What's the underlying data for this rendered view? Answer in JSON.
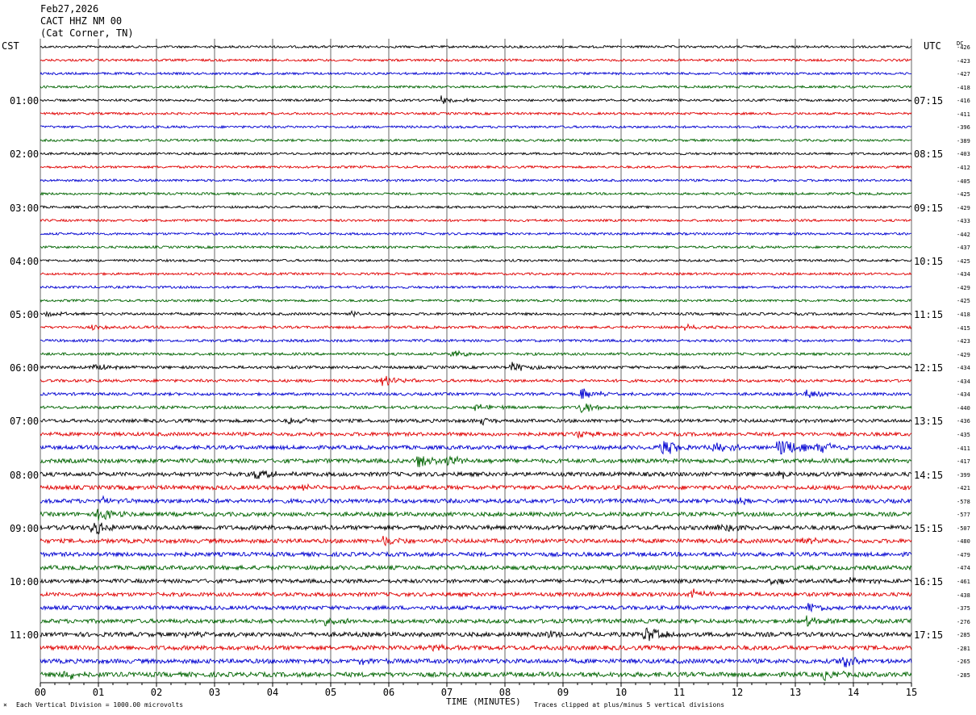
{
  "header": {
    "date": "Feb27,2026",
    "station": "CACT HHZ NM 00",
    "location": "(Cat Corner, TN)"
  },
  "axes": {
    "left_zone": "CST",
    "right_zone": "UTC",
    "dc_header": "DC",
    "xlabel": "TIME (MINUTES)",
    "footer_left": "Each Vertical Division = 1000.00 microvolts",
    "footer_right": "Traces clipped at plus/minus 5 vertical divisions",
    "footer_mark": "×"
  },
  "chart_data": {
    "type": "line",
    "title": "",
    "x_ticks": [
      "00",
      "01",
      "02",
      "03",
      "04",
      "05",
      "06",
      "07",
      "08",
      "09",
      "10",
      "11",
      "12",
      "13",
      "14",
      "15"
    ],
    "xlim": [
      0,
      15
    ],
    "trace_colors": [
      "#000000",
      "#e00000",
      "#0000d0",
      "#006400"
    ],
    "left_time_labels": [
      {
        "row": 4,
        "text": "01:00"
      },
      {
        "row": 8,
        "text": "02:00"
      },
      {
        "row": 12,
        "text": "03:00"
      },
      {
        "row": 16,
        "text": "04:00"
      },
      {
        "row": 20,
        "text": "05:00"
      },
      {
        "row": 24,
        "text": "06:00"
      },
      {
        "row": 28,
        "text": "07:00"
      },
      {
        "row": 32,
        "text": "08:00"
      },
      {
        "row": 36,
        "text": "09:00"
      },
      {
        "row": 40,
        "text": "10:00"
      },
      {
        "row": 44,
        "text": "11:00"
      }
    ],
    "right_time_labels": [
      {
        "row": 4,
        "text": "07:15"
      },
      {
        "row": 8,
        "text": "08:15"
      },
      {
        "row": 12,
        "text": "09:15"
      },
      {
        "row": 16,
        "text": "10:15"
      },
      {
        "row": 20,
        "text": "11:15"
      },
      {
        "row": 24,
        "text": "12:15"
      },
      {
        "row": 28,
        "text": "13:15"
      },
      {
        "row": 32,
        "text": "14:15"
      },
      {
        "row": 36,
        "text": "15:15"
      },
      {
        "row": 40,
        "text": "16:15"
      },
      {
        "row": 44,
        "text": "17:15"
      }
    ],
    "dc_offsets": [
      "-426",
      "-423",
      "-427",
      "-418",
      "-416",
      "-411",
      "-396",
      "-389",
      "-403",
      "-412",
      "-405",
      "-425",
      "-429",
      "-433",
      "-442",
      "-437",
      "-425",
      "-434",
      "-429",
      "-425",
      "-418",
      "-415",
      "-423",
      "-429",
      "-434",
      "-434",
      "-434",
      "-440",
      "-436",
      "-435",
      "-411",
      "-417",
      "-399",
      "-421",
      "-578",
      "-577",
      "-507",
      "-480",
      "-479",
      "-474",
      "-461",
      "-438",
      "-375",
      "-276",
      "-285",
      "-281",
      "-265",
      "-285"
    ],
    "base_noise": [
      0.9,
      0.9,
      0.9,
      0.9,
      0.9,
      0.9,
      0.9,
      0.9,
      0.9,
      0.9,
      0.9,
      0.9,
      0.9,
      0.9,
      0.9,
      0.9,
      0.9,
      0.9,
      0.9,
      0.9,
      1.0,
      1.0,
      1.0,
      1.0,
      1.1,
      1.1,
      1.1,
      1.1,
      1.3,
      1.4,
      1.5,
      1.6,
      1.6,
      1.6,
      1.6,
      1.6,
      1.7,
      1.6,
      1.6,
      1.6,
      1.5,
      1.5,
      1.5,
      1.6,
      1.7,
      1.7,
      1.7,
      1.8
    ],
    "events": [
      {
        "row": 4,
        "minute": 6.9,
        "amp": 5
      },
      {
        "row": 20,
        "minute": 0.1,
        "amp": 3
      },
      {
        "row": 20,
        "minute": 5.3,
        "amp": 3
      },
      {
        "row": 21,
        "minute": 0.9,
        "amp": 3
      },
      {
        "row": 21,
        "minute": 11.1,
        "amp": 3
      },
      {
        "row": 23,
        "minute": 7.1,
        "amp": 4
      },
      {
        "row": 24,
        "minute": 0.9,
        "amp": 5
      },
      {
        "row": 24,
        "minute": 8.1,
        "amp": 7
      },
      {
        "row": 25,
        "minute": 5.9,
        "amp": 7
      },
      {
        "row": 26,
        "minute": 9.3,
        "amp": 9
      },
      {
        "row": 26,
        "minute": 13.2,
        "amp": 5
      },
      {
        "row": 27,
        "minute": 7.5,
        "amp": 5
      },
      {
        "row": 27,
        "minute": 9.3,
        "amp": 8
      },
      {
        "row": 28,
        "minute": 4.3,
        "amp": 4
      },
      {
        "row": 28,
        "minute": 7.6,
        "amp": 4
      },
      {
        "row": 29,
        "minute": 9.2,
        "amp": 5
      },
      {
        "row": 30,
        "minute": 10.7,
        "amp": 12
      },
      {
        "row": 30,
        "minute": 11.6,
        "amp": 8
      },
      {
        "row": 30,
        "minute": 12.7,
        "amp": 18
      },
      {
        "row": 30,
        "minute": 13.4,
        "amp": 9
      },
      {
        "row": 31,
        "minute": 6.5,
        "amp": 10
      },
      {
        "row": 31,
        "minute": 7.0,
        "amp": 8
      },
      {
        "row": 32,
        "minute": 3.7,
        "amp": 8
      },
      {
        "row": 32,
        "minute": 12.7,
        "amp": 6
      },
      {
        "row": 33,
        "minute": 4.5,
        "amp": 4
      },
      {
        "row": 34,
        "minute": 1.1,
        "amp": 5
      },
      {
        "row": 34,
        "minute": 12.0,
        "amp": 5
      },
      {
        "row": 35,
        "minute": 1.0,
        "amp": 8
      },
      {
        "row": 36,
        "minute": 0.9,
        "amp": 10
      },
      {
        "row": 36,
        "minute": 11.7,
        "amp": 5
      },
      {
        "row": 37,
        "minute": 5.9,
        "amp": 7
      },
      {
        "row": 37,
        "minute": 13.1,
        "amp": 4
      },
      {
        "row": 40,
        "minute": 12.6,
        "amp": 5
      },
      {
        "row": 40,
        "minute": 13.9,
        "amp": 5
      },
      {
        "row": 41,
        "minute": 11.2,
        "amp": 6
      },
      {
        "row": 42,
        "minute": 13.2,
        "amp": 7
      },
      {
        "row": 43,
        "minute": 13.2,
        "amp": 6
      },
      {
        "row": 43,
        "minute": 4.9,
        "amp": 4
      },
      {
        "row": 44,
        "minute": 10.4,
        "amp": 12
      },
      {
        "row": 44,
        "minute": 8.7,
        "amp": 5
      },
      {
        "row": 44,
        "minute": 2.5,
        "amp": 4
      },
      {
        "row": 45,
        "minute": 6.7,
        "amp": 5
      },
      {
        "row": 46,
        "minute": 13.8,
        "amp": 9
      },
      {
        "row": 46,
        "minute": 5.5,
        "amp": 4
      },
      {
        "row": 47,
        "minute": 0.4,
        "amp": 7
      },
      {
        "row": 47,
        "minute": 13.5,
        "amp": 6
      }
    ]
  }
}
